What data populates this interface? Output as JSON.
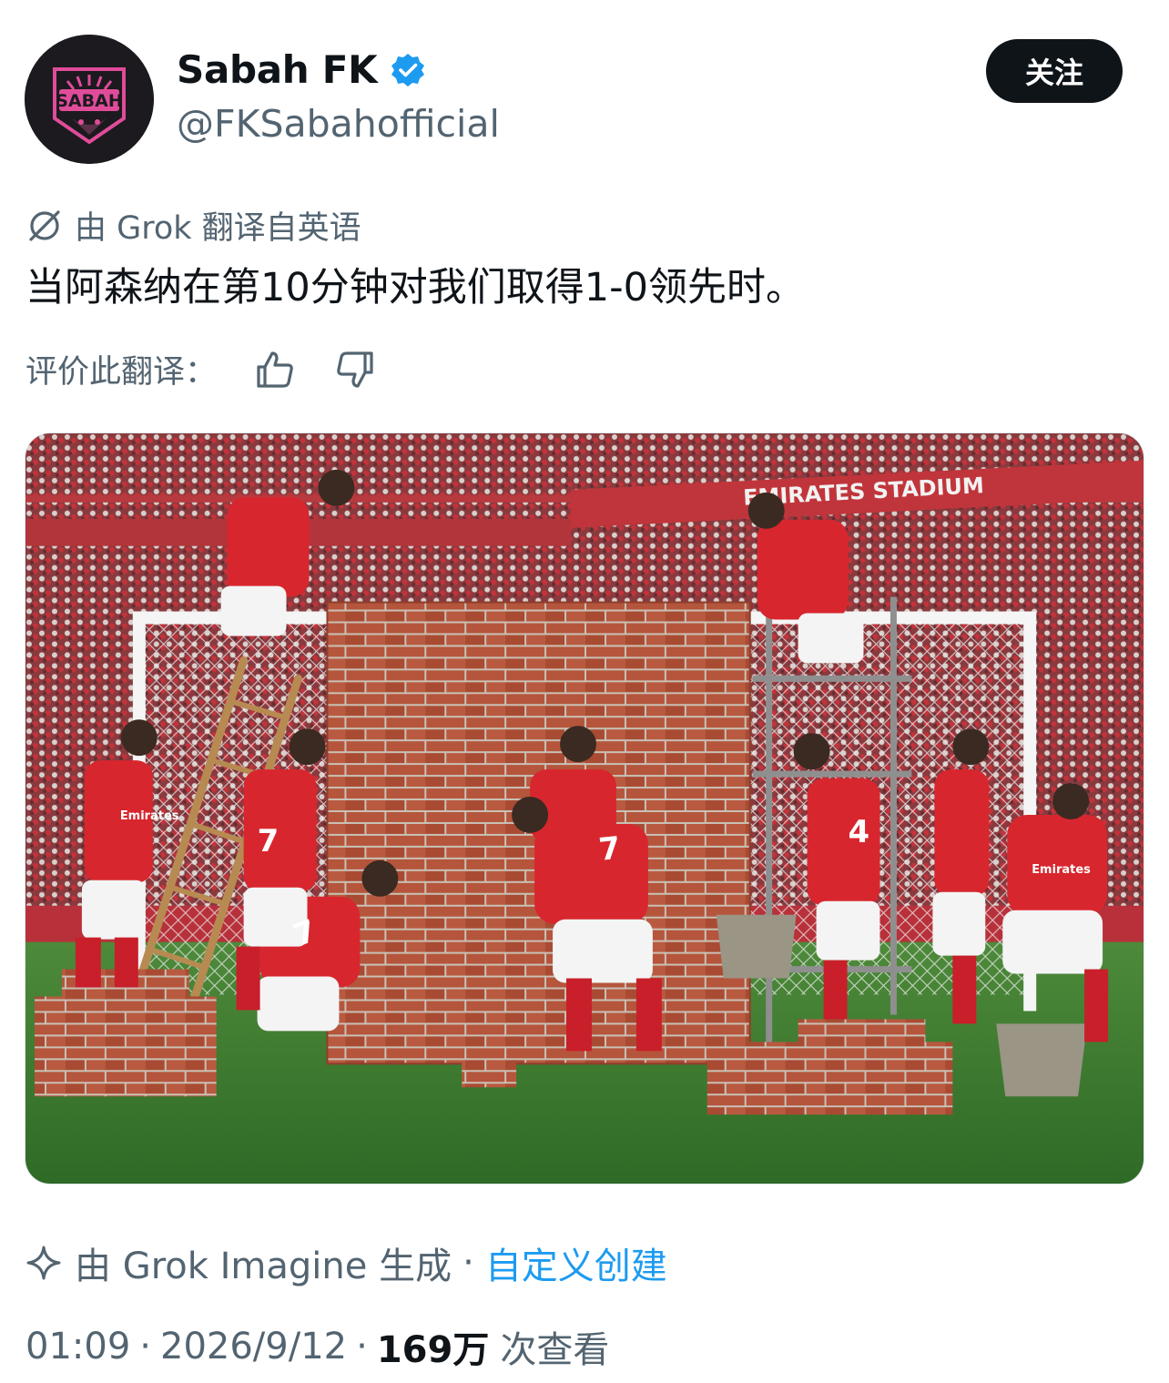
{
  "author": {
    "display_name": "Sabah FK",
    "handle": "@FKSabahofficial",
    "avatar_text": "SABAH",
    "verified": true
  },
  "follow_label": "关注",
  "translation": {
    "label": "由 Grok 翻译自英语",
    "text": "当阿森纳在第10分钟对我们取得1-0领先时。",
    "rate_label": "评价此翻译："
  },
  "media": {
    "stadium_sign": "EMIRATES STADIUM",
    "sponsor_text": "Emirates"
  },
  "generation": {
    "label": "由 Grok Imagine 生成",
    "separator": "·",
    "link": "自定义创建"
  },
  "meta": {
    "time": "01:09",
    "separator": "·",
    "date": "2026/9/12",
    "views_count": "169万",
    "views_label": "次查看"
  },
  "colors": {
    "verified": "#1d9bf0",
    "link": "#1d9bf0",
    "secondary_text": "#536471",
    "follow_button": "#0f1419",
    "avatar_accent": "#e04c9a"
  }
}
